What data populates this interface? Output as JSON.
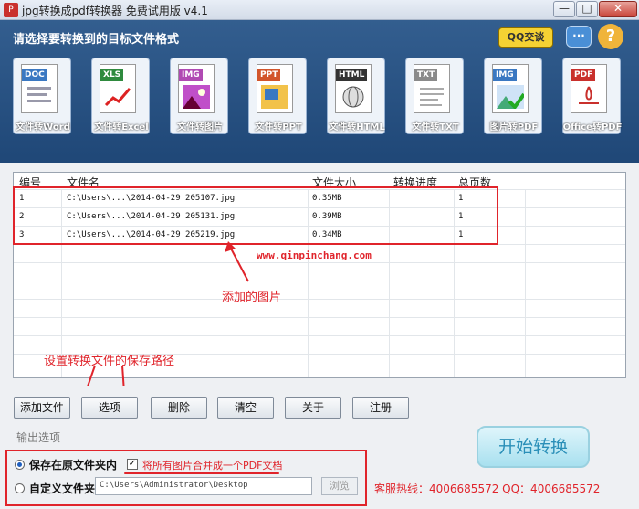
{
  "window": {
    "title": "jpg转换成pdf转换器 免费试用版 v4.1",
    "min": "—",
    "max": "□",
    "close": "✕"
  },
  "header": {
    "heading": "请选择要转换到的目标文件格式",
    "qq_button": "QQ交谈",
    "help": "?"
  },
  "tools": [
    {
      "tag": "DOC",
      "label": "文件转Word",
      "color": "#3a78c2"
    },
    {
      "tag": "XLS",
      "label": "文件转Excel",
      "color": "#2f8a3e"
    },
    {
      "tag": "IMG",
      "label": "文件转图片",
      "color": "#b04ab3"
    },
    {
      "tag": "PPT",
      "label": "文件转PPT",
      "color": "#d2552b"
    },
    {
      "tag": "HTML",
      "label": "文件转HTML",
      "color": "#333333"
    },
    {
      "tag": "TXT",
      "label": "文件转TXT",
      "color": "#8a8a8a"
    },
    {
      "tag": "IMG",
      "label": "图片转PDF",
      "color": "#3a78c2"
    },
    {
      "tag": "PDF",
      "label": "Office转PDF",
      "color": "#c9302c"
    }
  ],
  "table": {
    "columns": [
      "编号",
      "文件名",
      "文件大小",
      "转换进度",
      "总页数"
    ],
    "rows": [
      [
        "1",
        "C:\\Users\\...\\2014-04-29 205107.jpg",
        "0.35MB",
        "",
        "1"
      ],
      [
        "2",
        "C:\\Users\\...\\2014-04-29 205131.jpg",
        "0.39MB",
        "",
        "1"
      ],
      [
        "3",
        "C:\\Users\\...\\2014-04-29 205219.jpg",
        "0.34MB",
        "",
        "1"
      ]
    ]
  },
  "annotations": {
    "url": "www.qinpinchang.com",
    "added_images": "添加的图片",
    "save_path": "设置转换文件的保存路径"
  },
  "buttons": {
    "add_file": "添加文件",
    "options": "选项",
    "delete": "删除",
    "clear": "清空",
    "about": "关于",
    "register": "注册"
  },
  "output": {
    "section": "输出选项",
    "save_original": "保存在原文件夹内",
    "merge_check": "✓",
    "merge_label": "将所有图片合并成一个PDF文档",
    "custom_folder": "自定义文件夹",
    "path_value": "C:\\Users\\Administrator\\Desktop",
    "browse": "浏览",
    "start": "开始转换",
    "hotline": "客服热线：4006685572 QQ：4006685572"
  }
}
